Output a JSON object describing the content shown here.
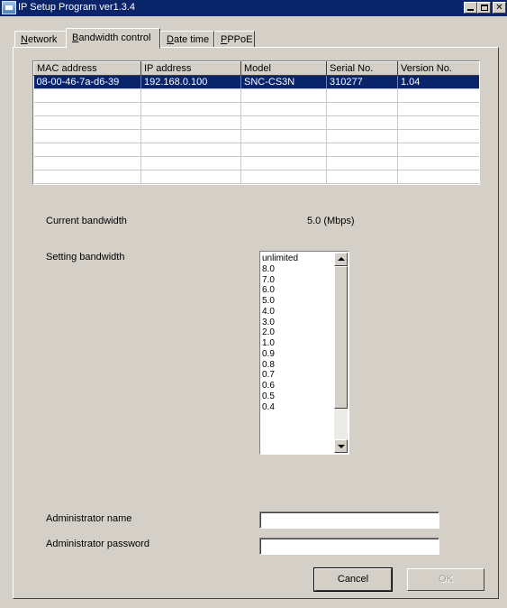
{
  "window": {
    "title": "IP Setup Program ver1.3.4"
  },
  "tabs": [
    {
      "prefix": "",
      "accel": "N",
      "rest": "etwork"
    },
    {
      "prefix": "",
      "accel": "B",
      "rest": "andwidth control"
    },
    {
      "prefix": "",
      "accel": "D",
      "rest": "ate time"
    },
    {
      "prefix": "",
      "accel": "P",
      "rest": "PPoE"
    }
  ],
  "active_tab": "Bandwidth control",
  "device_list": {
    "columns": [
      "MAC address",
      "IP address",
      "Model",
      "Serial No.",
      "Version No."
    ],
    "rows": [
      [
        "08-00-46-7a-d6-39",
        "192.168.0.100",
        "SNC-CS3N",
        "310277",
        "1.04"
      ]
    ],
    "selected_row": 0
  },
  "bandwidth": {
    "current_label": "Current bandwidth",
    "current_value": "5.0  (Mbps)",
    "setting_label": "Setting bandwidth",
    "options": [
      "unlimited",
      "8.0",
      "7.0",
      "6.0",
      "5.0",
      "4.0",
      "3.0",
      "2.0",
      "1.0",
      "0.9",
      "0.8",
      "0.7",
      "0.6",
      "0.5",
      "0.4"
    ]
  },
  "admin": {
    "name_label": "Administrator name",
    "name_value": "",
    "password_label": "Administrator password",
    "password_value": ""
  },
  "buttons": {
    "cancel": "Cancel",
    "ok": "OK"
  },
  "colors": {
    "titlebar": "#0a246a",
    "selection": "#0a246a",
    "face": "#d4d0c8"
  },
  "icons": {
    "app": "network-setup-icon",
    "minimize": "minimize-icon",
    "maximize": "maximize-icon",
    "close": "close-icon"
  }
}
